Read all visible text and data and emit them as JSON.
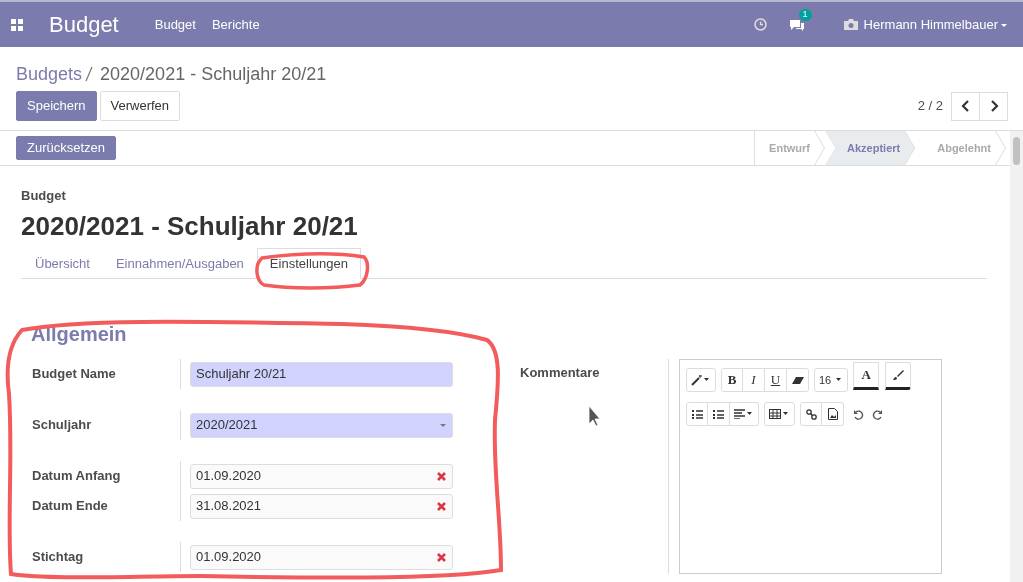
{
  "navbar": {
    "app_title": "Budget",
    "menu": [
      "Budget",
      "Berichte"
    ],
    "message_count": "1",
    "user": "Hermann Himmelbauer"
  },
  "breadcrumb": {
    "parent": "Budgets",
    "current": "2020/2021 - Schuljahr 20/21"
  },
  "buttons": [
    {
      "label": "Speichern",
      "kind": "primary"
    },
    {
      "label": "Verwerfen",
      "kind": "secondary"
    }
  ],
  "pager": "2 / 2",
  "action_button": "Zurücksetzen",
  "stages": [
    {
      "label": "Entwurf",
      "selected": false
    },
    {
      "label": "Akzeptiert",
      "selected": true
    },
    {
      "label": "Abgelehnt",
      "selected": false
    }
  ],
  "form": {
    "label": "Budget",
    "title": "2020/2021 - Schuljahr 20/21",
    "tabs": [
      {
        "label": "Übersicht",
        "selected": false
      },
      {
        "label": "Einnahmen/Ausgaben",
        "selected": false
      },
      {
        "label": "Einstellungen",
        "selected": true
      }
    ],
    "section": "Allgemein",
    "field_groups": [
      [
        {
          "label": "Budget Name",
          "kind": "text",
          "value": "Schuljahr 20/21",
          "required": true
        }
      ],
      [
        {
          "label": "Schuljahr",
          "kind": "select",
          "value": "2020/2021",
          "required": true
        }
      ],
      [
        {
          "label": "Datum Anfang",
          "kind": "date",
          "value": "01.09.2020",
          "required": false
        },
        {
          "label": "Datum Ende",
          "kind": "date",
          "value": "31.08.2021",
          "required": false
        }
      ],
      [
        {
          "label": "Stichtag",
          "kind": "date",
          "value": "01.09.2020",
          "required": false
        }
      ]
    ],
    "comment_label": "Kommentare",
    "editor": {
      "format_buttons": [
        "B",
        "I",
        "U"
      ],
      "font_size": "16",
      "font_color_button": "A"
    }
  }
}
